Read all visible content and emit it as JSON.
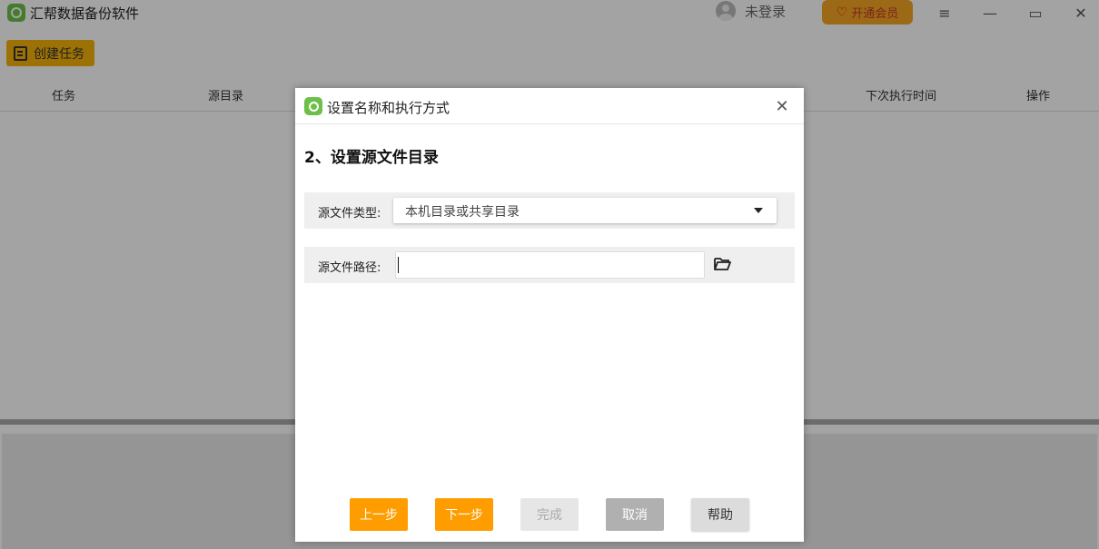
{
  "app": {
    "title": "汇帮数据备份软件",
    "user": {
      "login_label": "未登录"
    },
    "vip_label": "开通会员",
    "window_controls": {
      "menu": "≡",
      "minimize": "—",
      "maximize": "▭",
      "close": "✕"
    },
    "toolbar": {
      "create_task_label": "创建任务"
    },
    "table_headers": [
      "任务",
      "源目录",
      "下次执行时间",
      "操作"
    ]
  },
  "dialog": {
    "title": "设置名称和执行方式",
    "step_title": "2、设置源文件目录",
    "source_type": {
      "label": "源文件类型:",
      "selected": "本机目录或共享目录"
    },
    "source_path": {
      "label": "源文件路径:",
      "value": ""
    },
    "buttons": {
      "prev": "上一步",
      "next": "下一步",
      "finish": "完成",
      "cancel": "取消",
      "help": "帮助"
    }
  },
  "colors": {
    "accent_orange": "#ff9d00",
    "create_button": "#f5b30a",
    "vip_button": "#f5a623",
    "logo_green": "#6cc04a"
  },
  "icons": {
    "app_logo": "app-logo-icon",
    "avatar": "user-avatar-icon",
    "vip": "heart-icon",
    "create_task": "document-icon",
    "dropdown": "caret-down-icon",
    "browse": "folder-open-icon",
    "close": "close-icon"
  }
}
